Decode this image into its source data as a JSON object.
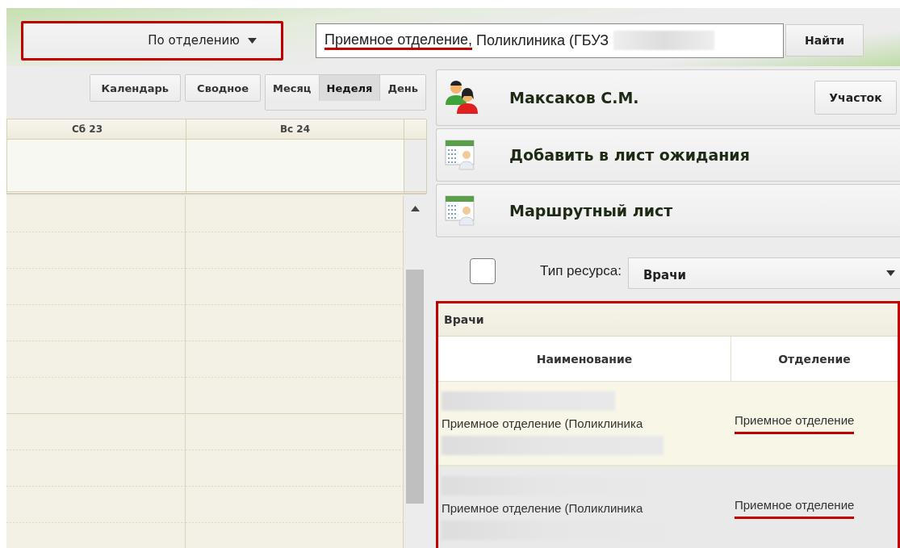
{
  "top_bar": {
    "mode_dropdown": {
      "label": "По отделению",
      "highlighted": true
    },
    "search": {
      "segments": [
        {
          "text": "Приемное отделение,",
          "underlined": true
        },
        {
          "text": " Поликлиника (ГБУЗ",
          "underlined": false
        }
      ]
    },
    "search_button": "Найти"
  },
  "calendar": {
    "toolbar": {
      "buttons": [
        "Календарь",
        "Сводное"
      ],
      "views": [
        {
          "label": "Месяц",
          "selected": false
        },
        {
          "label": "Неделя",
          "selected": true
        },
        {
          "label": "День",
          "selected": false
        }
      ]
    },
    "columns": [
      "Сб 23",
      "Вс 24"
    ]
  },
  "actions": [
    {
      "kind": "patient",
      "label": "Максаков С.М.",
      "button": "Участок"
    },
    {
      "kind": "list",
      "label": "Добавить в лист ожидания"
    },
    {
      "kind": "list",
      "label": "Маршрутный лист"
    }
  ],
  "resource_filter": {
    "checked": false,
    "label": "Тип ресурса:",
    "value": "Врачи"
  },
  "doctors_panel": {
    "title": "Врачи",
    "highlighted": true,
    "columns": [
      "Наименование",
      "Отделение"
    ],
    "rows": [
      {
        "name": "Приемное отделение (Поликлиника",
        "department": "Приемное отделение",
        "underlined": true,
        "selected": true
      },
      {
        "name": "Приемное отделение (Поликлиника",
        "department": "Приемное отделение",
        "underlined": true,
        "selected": false
      }
    ]
  }
}
